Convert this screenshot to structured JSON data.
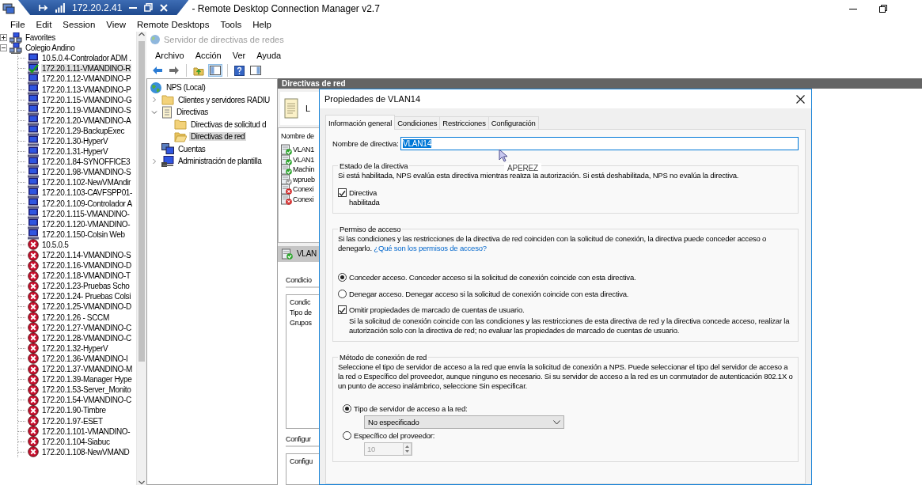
{
  "window": {
    "title": "- Remote Desktop Connection Manager v2.7"
  },
  "connection_bar": {
    "host": "172.20.2.41"
  },
  "menu": [
    "File",
    "Edit",
    "Session",
    "View",
    "Remote Desktops",
    "Tools",
    "Help"
  ],
  "servers_tree": [
    {
      "label": "Favorites",
      "expanded": false,
      "selected": false
    },
    {
      "label": "Colegio Andino",
      "expanded": true,
      "selected": false,
      "children": [
        {
          "label": "10.5.0.4-Controlador ADM .",
          "kind": "normal",
          "selected": false
        },
        {
          "label": "172.20.1.11-VMANDINO-R",
          "kind": "connected",
          "selected": true
        },
        {
          "label": "172.20.1.12-VMANDINO-P",
          "kind": "normal",
          "selected": false
        },
        {
          "label": "172.20.1.13-VMANDINO-P",
          "kind": "normal",
          "selected": false
        },
        {
          "label": "172.20.1.15-VMANDINO-G",
          "kind": "normal",
          "selected": false
        },
        {
          "label": "172.20.1.19-VMANDINO-S",
          "kind": "normal",
          "selected": false
        },
        {
          "label": "172.20.1.20-VMANDINO-A",
          "kind": "normal",
          "selected": false
        },
        {
          "label": "172.20.1.29-BackupExec",
          "kind": "normal",
          "selected": false
        },
        {
          "label": "172.20.1.30-HyperV",
          "kind": "normal",
          "selected": false
        },
        {
          "label": "172.20.1.31-HyperV",
          "kind": "normal",
          "selected": false
        },
        {
          "label": "172.20.1.84-SYNOFFICE3",
          "kind": "normal",
          "selected": false
        },
        {
          "label": "172.20.1.98-VMANDINO-S",
          "kind": "normal",
          "selected": false
        },
        {
          "label": "172.20.1.102-NewVMAndir",
          "kind": "normal",
          "selected": false
        },
        {
          "label": "172.20.1.103-CAVFSPP01-",
          "kind": "normal",
          "selected": false
        },
        {
          "label": "172.20.1.109-Controlador A",
          "kind": "normal",
          "selected": false
        },
        {
          "label": "172.20.1.115-VMANDINO-",
          "kind": "normal",
          "selected": false
        },
        {
          "label": "172.20.1.120-VMANDINO-",
          "kind": "normal",
          "selected": false
        },
        {
          "label": "172.20.1.150-Colsin Web",
          "kind": "normal",
          "selected": false
        },
        {
          "label": "10.5.0.5",
          "kind": "error",
          "selected": false
        },
        {
          "label": "172.20.1.14-VMANDINO-S",
          "kind": "error",
          "selected": false
        },
        {
          "label": "172.20.1.16-VMANDINO-D",
          "kind": "error",
          "selected": false
        },
        {
          "label": "172.20.1.18-VMANDINO-T",
          "kind": "error",
          "selected": false
        },
        {
          "label": "172.20.1.23-Pruebas Scho",
          "kind": "error",
          "selected": false
        },
        {
          "label": "172.20.1.24- Pruebas Colsi",
          "kind": "error",
          "selected": false
        },
        {
          "label": "172.20.1.25-VMANDINO-D",
          "kind": "error",
          "selected": false
        },
        {
          "label": "172.20.1.26 - SCCM",
          "kind": "error",
          "selected": false
        },
        {
          "label": "172.20.1.27-VMANDINO-C",
          "kind": "error",
          "selected": false
        },
        {
          "label": "172.20.1.28-VMANDINO-C",
          "kind": "error",
          "selected": false
        },
        {
          "label": "172.20.1.32-HyperV",
          "kind": "error",
          "selected": false
        },
        {
          "label": "172.20.1.36-VMANDINO-I",
          "kind": "error",
          "selected": false
        },
        {
          "label": "172.20.1.37-VMANDINO-M",
          "kind": "error",
          "selected": false
        },
        {
          "label": "172.20.1.39-Manager Hype",
          "kind": "error",
          "selected": false
        },
        {
          "label": "172.20.1.53-Server_Monito",
          "kind": "error",
          "selected": false
        },
        {
          "label": "172.20.1.54-VMANDINO-C",
          "kind": "error",
          "selected": false
        },
        {
          "label": "172.20.1.90-Timbre",
          "kind": "error",
          "selected": false
        },
        {
          "label": "172.20.1.97-ESET",
          "kind": "error",
          "selected": false
        },
        {
          "label": "172.20.1.101-VMANDINO-",
          "kind": "error",
          "selected": false
        },
        {
          "label": "172.20.1.104-Siabuc",
          "kind": "error",
          "selected": false
        },
        {
          "label": "172.20.1.108-NewVMAND",
          "kind": "error",
          "selected": false
        }
      ]
    }
  ],
  "remote": {
    "window_title": "Servidor de directivas de redes",
    "menu": [
      "Archivo",
      "Acción",
      "Ver",
      "Ayuda"
    ],
    "tree": [
      {
        "label": "NPS (Local)",
        "kind": "server",
        "selected": false,
        "children": [
          {
            "label": "Clientes y servidores RADIU",
            "kind": "folder",
            "expanded": false,
            "selected": false
          },
          {
            "label": "Directivas",
            "kind": "policy",
            "expanded": true,
            "selected": false,
            "children": [
              {
                "label": "Directivas de solicitud d",
                "kind": "folder",
                "selected": false
              },
              {
                "label": "Directivas de red",
                "kind": "open-folder",
                "selected": true
              }
            ]
          },
          {
            "label": "Cuentas",
            "kind": "accounts",
            "selected": false
          },
          {
            "label": "Administración de plantilla",
            "kind": "admin",
            "expanded": false,
            "selected": false
          }
        ]
      }
    ],
    "pane": {
      "header": "Directivas de red",
      "intro": "L",
      "list_header": "Nombre de",
      "policies": [
        {
          "name": "VLAN1",
          "kind": "enabled"
        },
        {
          "name": "VLAN1",
          "kind": "enabled"
        },
        {
          "name": "Machin",
          "kind": "enabled"
        },
        {
          "name": "wprueb",
          "kind": "disabled"
        },
        {
          "name": "Conexi",
          "kind": "denied"
        },
        {
          "name": "Conexi",
          "kind": "denied"
        }
      ],
      "details_title": "VLAN",
      "conditions_heading": "Condicio",
      "conditions": [
        "Condic",
        "Tipo de",
        "Grupos"
      ],
      "settings_heading": "Configur",
      "settings": [
        "Configu"
      ]
    }
  },
  "dialog": {
    "title": "Propiedades de VLAN14",
    "tabs": [
      {
        "label": "Información general",
        "selected": true
      },
      {
        "label": "Condiciones",
        "selected": false
      },
      {
        "label": "Restricciones",
        "selected": false
      },
      {
        "label": "Configuración",
        "selected": false
      }
    ],
    "name_label": "Nombre de directiva:",
    "name_value": "VLAN14",
    "tooltip": "APEREZ",
    "state_group": {
      "title": "Estado de la directiva",
      "description": "Si está habilitada, NPS evalúa esta directiva mientras realiza la autorización. Si está deshabilitada, NPS no evalúa la directiva.",
      "checkbox": {
        "label": "Directiva habilitada",
        "checked": true
      }
    },
    "access_group": {
      "title": "Permiso de acceso",
      "description": "Si las condiciones y las restricciones de la directiva de red coinciden con la solicitud de conexión, la directiva puede conceder acceso o denegarlo.",
      "link": "¿Qué son los permisos de acceso?",
      "options": [
        {
          "label": "Conceder acceso. Conceder acceso si la solicitud de conexión coincide con esta directiva.",
          "selected": true
        },
        {
          "label": "Denegar acceso. Denegar acceso si la solicitud de conexión coincide con esta directiva.",
          "selected": false
        }
      ],
      "checkbox": {
        "label": "Omitir propiedades de marcado de cuentas de usuario.",
        "checked": true,
        "description": "Si la solicitud de conexión coincide con las condiciones y las restricciones de esta directiva de red y la directiva concede acceso, realizar la autorización solo con la directiva de red; no evaluar las propiedades de marcado de cuentas de usuario."
      }
    },
    "method_group": {
      "title": "Método de conexión de red",
      "description": "Seleccione el tipo de servidor de acceso a la red que envía la solicitud de conexión a NPS. Puede seleccionar el tipo del servidor de acceso a la red o Específico del proveedor, aunque ninguno es necesario. Si su servidor de acceso a la red es un conmutador de autenticación 802.1X o un punto de acceso inalámbrico, seleccione Sin especificar.",
      "options": [
        {
          "label": "Tipo de servidor de acceso a la red:",
          "selected": true,
          "kind": "dropdown",
          "value": "No especificado",
          "disabled": false
        },
        {
          "label": "Específico del proveedor:",
          "selected": false,
          "kind": "spinner",
          "value": "10",
          "disabled": true
        }
      ]
    }
  }
}
